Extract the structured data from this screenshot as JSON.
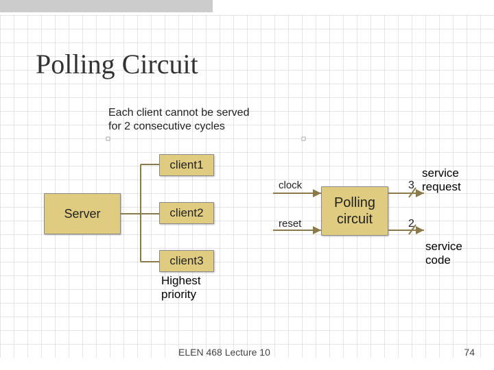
{
  "title": "Polling Circuit",
  "subtitle_line1": "Each client cannot be served",
  "subtitle_line2": "for 2 consecutive cycles",
  "server": {
    "label": "Server"
  },
  "clients": {
    "c1": "client1",
    "c2": "client2",
    "c3": "client3",
    "c3_note_line1": "Highest",
    "c3_note_line2": "priority"
  },
  "polling": {
    "line1": "Polling",
    "line2": "circuit"
  },
  "signals": {
    "clock": "clock",
    "reset": "reset",
    "service_request_line1": "service",
    "service_request_line2": "request",
    "service_code_line1": "service",
    "service_code_line2": "code",
    "bus3": "3",
    "bus2": "2"
  },
  "footer": {
    "lecture": "ELEN 468 Lecture 10",
    "page": "74"
  }
}
